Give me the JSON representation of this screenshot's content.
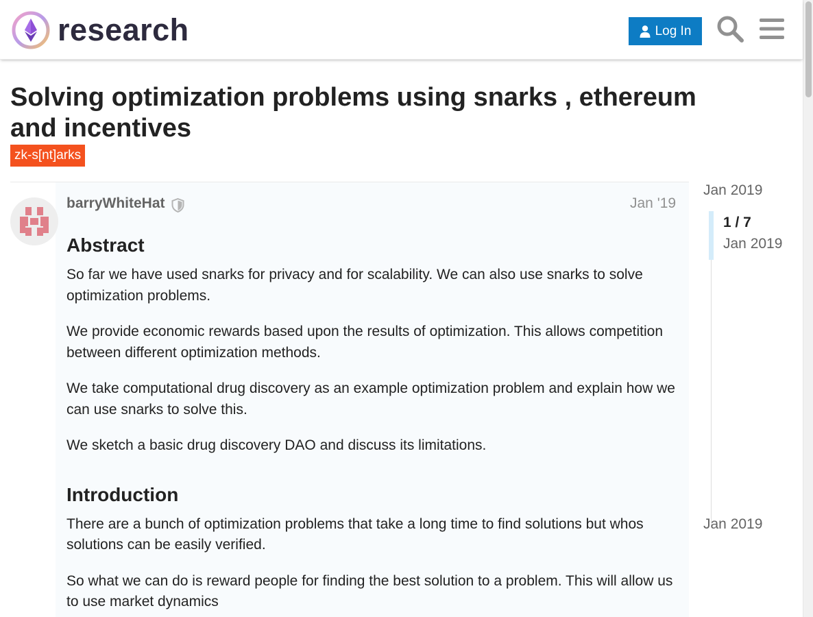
{
  "header": {
    "logo_text": "research",
    "login_label": "Log In",
    "icons": [
      "user-icon",
      "search-icon",
      "menu-icon"
    ]
  },
  "topic": {
    "title": "Solving optimization problems using snarks , ethereum and incentives",
    "tag": "zk-s[nt]arks"
  },
  "post": {
    "author": "barryWhiteHat",
    "date": "Jan '19",
    "sections": {
      "abstract_heading": "Abstract",
      "abstract_p1": "So far we have used snarks for privacy and for scalability. We can also use snarks to solve optimization problems.",
      "abstract_p2": "We provide economic rewards based upon the results of optimization. This allows competition between different optimization methods.",
      "abstract_p3": "We take computational drug discovery as an example optimization problem and explain how we can use snarks to solve this.",
      "abstract_p4": "We sketch a basic drug discovery DAO and discuss its limitations.",
      "intro_heading": "Introduction",
      "intro_p1": "There are a bunch of optimization problems that take a long time to find solutions but whos solutions can be easily verified.",
      "intro_p2": "So what we can do is reward people for finding the best solution to a problem. This will allow us to use market dynamics"
    }
  },
  "timeline": {
    "start_date": "Jan 2019",
    "position": "1 / 7",
    "current_date": "Jan 2019",
    "end_date": "Jan 2019"
  },
  "colors": {
    "brand_blue": "#0d7cc4",
    "tag_orange": "#f4511e",
    "post_bg": "#f8fbfd",
    "timeline_handle": "#d4ecfa"
  }
}
